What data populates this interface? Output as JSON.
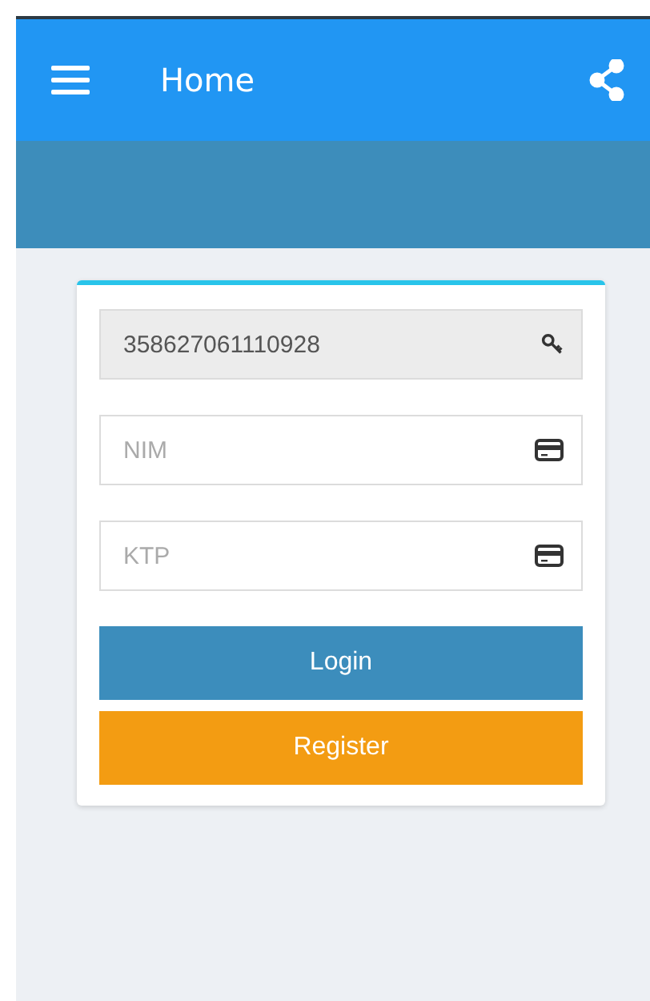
{
  "app_bar": {
    "title": "Home"
  },
  "fields": [
    {
      "kind": "readonly",
      "value": "358627061110928",
      "disabled": true
    },
    {
      "kind": "input",
      "placeholder": "NIM",
      "disabled": false
    },
    {
      "kind": "input",
      "placeholder": "KTP",
      "disabled": false
    }
  ],
  "buttons": [
    {
      "label": "Login",
      "kind": "primary"
    },
    {
      "label": "Register",
      "kind": "warning"
    }
  ]
}
